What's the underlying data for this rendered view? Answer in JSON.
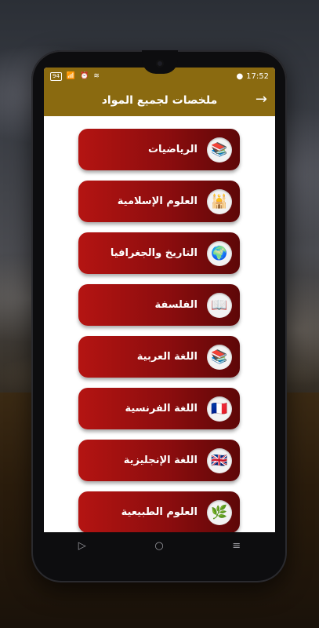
{
  "status": {
    "time": "17:52",
    "battery": "94",
    "notif_icon": "notification-icon",
    "wifi_icon": "wifi-icon",
    "alarm_icon": "alarm-icon"
  },
  "appbar": {
    "title": "ملخصات لجميع المواد",
    "back_icon": "arrow-right-icon"
  },
  "subjects": [
    {
      "label": "الرياضيات",
      "icon": "books-icon",
      "glyph": "📚"
    },
    {
      "label": "العلوم الإسلامية",
      "icon": "mosque-icon",
      "glyph": "🕌"
    },
    {
      "label": "التاريخ والجغرافيا",
      "icon": "globe-icon",
      "glyph": "🌍"
    },
    {
      "label": "الفلسفة",
      "icon": "book-icon",
      "glyph": "📖"
    },
    {
      "label": "اللغة العربية",
      "icon": "stack-books-icon",
      "glyph": "📚"
    },
    {
      "label": "اللغة الفرنسية",
      "icon": "france-flag-icon",
      "glyph": "🇫🇷"
    },
    {
      "label": "اللغة الإنجليزية",
      "icon": "english-book-icon",
      "glyph": "🇬🇧"
    },
    {
      "label": "العلوم الطبيعية",
      "icon": "nature-icon",
      "glyph": "🌿"
    }
  ],
  "navbar": {
    "back": "▷",
    "home": "○",
    "menu": "≡"
  },
  "colors": {
    "accent": "#8a6a10",
    "button_start": "#b41412",
    "button_end": "#5e0708"
  }
}
